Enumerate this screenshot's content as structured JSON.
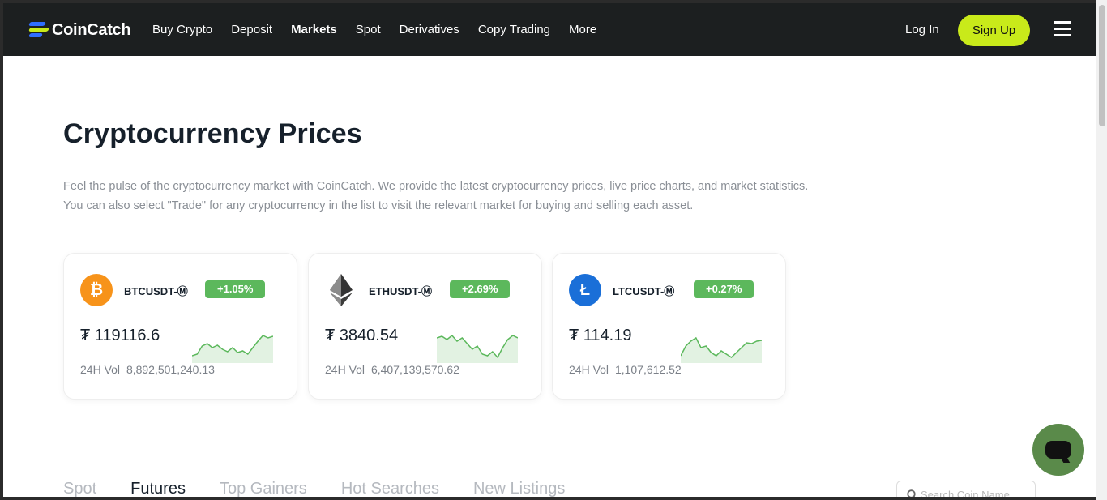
{
  "nav": {
    "logo": "CoinCatch",
    "items": [
      {
        "label": "Buy Crypto",
        "active": false
      },
      {
        "label": "Deposit",
        "active": false
      },
      {
        "label": "Markets",
        "active": true
      },
      {
        "label": "Spot",
        "active": false
      },
      {
        "label": "Derivatives",
        "active": false
      },
      {
        "label": "Copy Trading",
        "active": false
      },
      {
        "label": "More",
        "active": false
      }
    ],
    "login": "Log In",
    "signup": "Sign Up"
  },
  "page": {
    "title": "Cryptocurrency Prices",
    "intro_line1": "Feel the pulse of the cryptocurrency market with CoinCatch. We provide the latest cryptocurrency prices, live price charts, and market statistics.",
    "intro_line2": "You can also select \"Trade\" for any cryptocurrency in the list to visit the relevant market for buying and selling each asset."
  },
  "cards": [
    {
      "pair": "BTCUSDT-Ⓜ",
      "change": "+1.05%",
      "price": "₮ 119116.6",
      "vol_label": "24H Vol",
      "vol": "8,892,501,240.13",
      "icon": "bitcoin-icon",
      "color": "#f7931a",
      "spark": [
        30,
        28,
        18,
        15,
        20,
        17,
        22,
        25,
        20,
        26,
        24,
        28,
        20,
        12,
        5,
        8,
        6
      ]
    },
    {
      "pair": "ETHUSDT-Ⓜ",
      "change": "+2.69%",
      "price": "₮ 3840.54",
      "vol_label": "24H Vol",
      "vol": "6,407,139,570.62",
      "icon": "ethereum-icon",
      "color": "#627eea",
      "spark": [
        8,
        6,
        10,
        5,
        12,
        8,
        15,
        22,
        18,
        28,
        30,
        25,
        32,
        20,
        10,
        5,
        8
      ]
    },
    {
      "pair": "LTCUSDT-Ⓜ",
      "change": "+0.27%",
      "price": "₮ 114.19",
      "vol_label": "24H Vol",
      "vol": "1,107,612.52",
      "icon": "litecoin-icon",
      "color": "#1a6fd8",
      "spark": [
        30,
        18,
        12,
        8,
        20,
        18,
        26,
        30,
        24,
        28,
        32,
        26,
        20,
        14,
        15,
        12,
        11
      ]
    }
  ],
  "tabs": [
    {
      "label": "Spot",
      "active": false
    },
    {
      "label": "Futures",
      "active": true
    },
    {
      "label": "Top Gainers",
      "active": false
    },
    {
      "label": "Hot Searches",
      "active": false
    },
    {
      "label": "New Listings",
      "active": false
    }
  ],
  "search": {
    "placeholder": "Search Coin Name"
  },
  "colors": {
    "accent": "#c9ea1a",
    "up": "#5cb85c",
    "nav_bg": "#1c1f20"
  }
}
